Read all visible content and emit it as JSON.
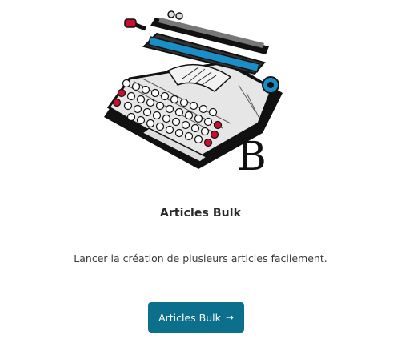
{
  "card": {
    "logo_letter": "B",
    "title": "Articles Bulk",
    "description": "Lancer la création de plusieurs articles facilement.",
    "button": {
      "label": "Articles Bulk",
      "icon": "arrow-right-icon",
      "icon_glyph": "→"
    }
  },
  "colors": {
    "button_bg": "#0c6f8c",
    "key_red": "#c8102e",
    "accent_blue": "#1a8fc7"
  },
  "illustration": {
    "subject": "typewriter-icon"
  }
}
